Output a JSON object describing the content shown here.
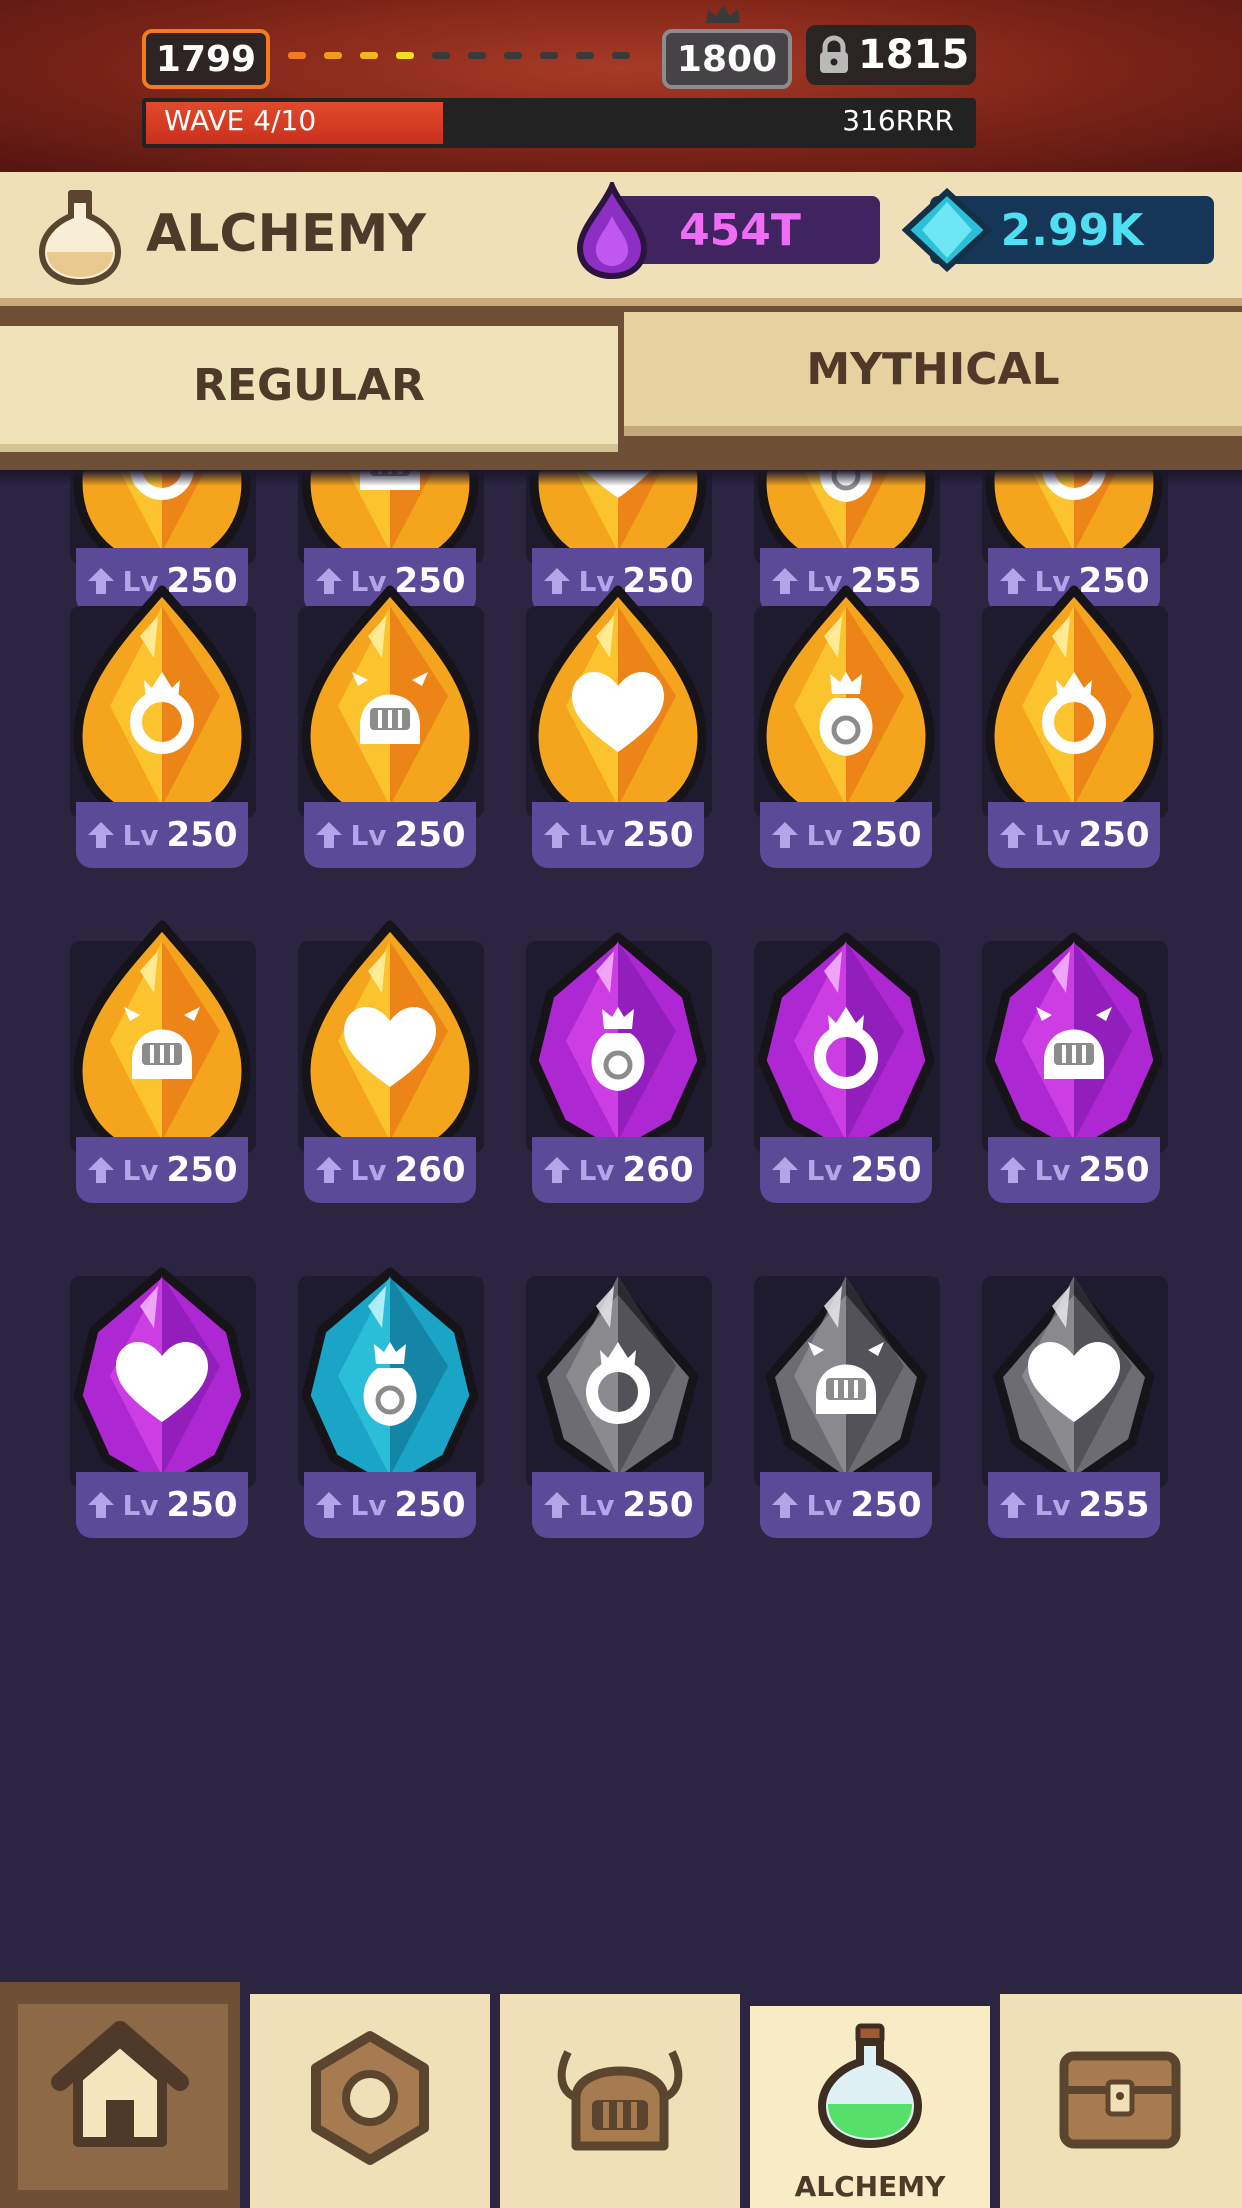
{
  "stage": {
    "current": "1799",
    "next": "1800",
    "locked": "1815"
  },
  "wave": {
    "label": "WAVE 4/10",
    "value": "316RRR",
    "progress": 0.36
  },
  "header": {
    "title": "ALCHEMY"
  },
  "currencies": {
    "elixir": "454T",
    "gems": "2.99K"
  },
  "tabs": {
    "regular": "REGULAR",
    "mythical": "MYTHICAL"
  },
  "badge_lv_prefix": "Lv",
  "gems": {
    "row0": [
      "250",
      "250",
      "250",
      "255",
      "250"
    ],
    "row1": [
      "250",
      "250",
      "250",
      "250",
      "250"
    ],
    "row2": [
      "250",
      "260",
      "260",
      "250",
      "250"
    ],
    "row3": [
      "250",
      "250",
      "250",
      "250",
      "255"
    ]
  },
  "colors": {
    "gold": "#f6a619",
    "purple": "#b62ad6",
    "blue": "#1aa6c8",
    "gray": "#6e6e74"
  },
  "nav": {
    "active_label": "ALCHEMY"
  }
}
